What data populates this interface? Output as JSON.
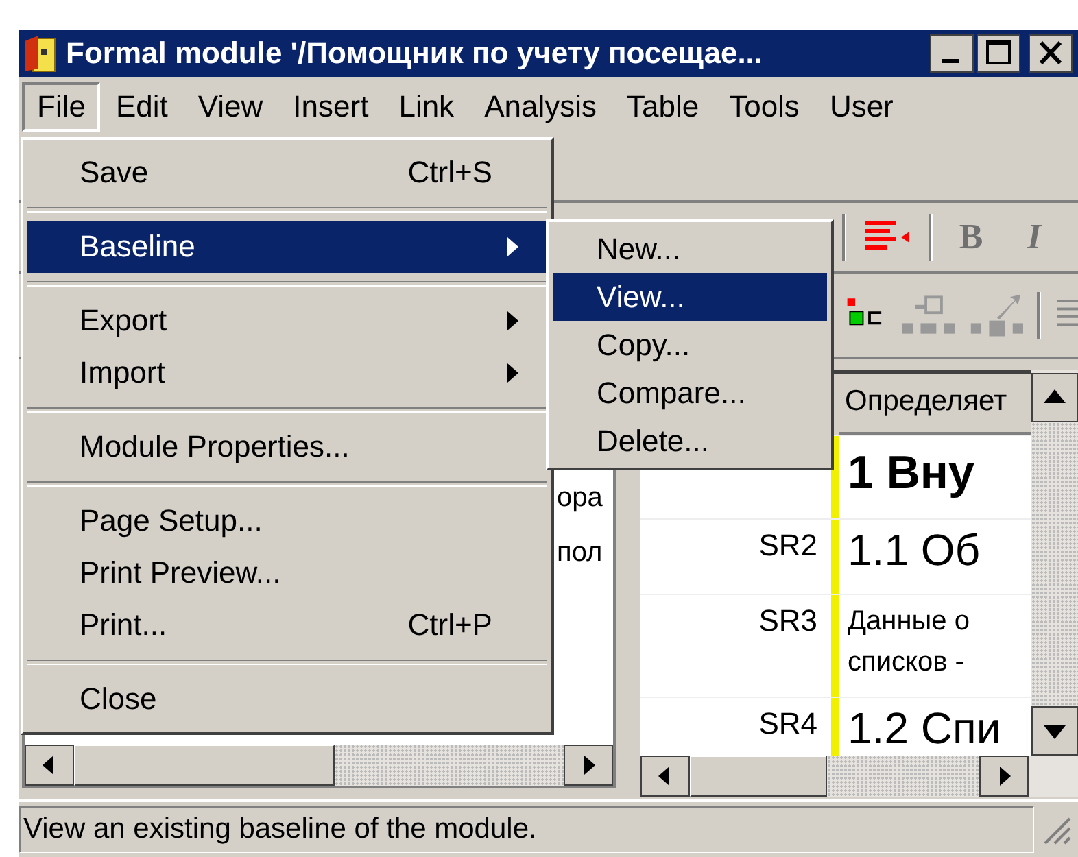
{
  "window": {
    "title": "Formal module '/Помощник по учету посещае..."
  },
  "menu_bar": [
    {
      "label": "File",
      "selected": true
    },
    {
      "label": "Edit",
      "selected": false
    },
    {
      "label": "View",
      "selected": false
    },
    {
      "label": "Insert",
      "selected": false
    },
    {
      "label": "Link",
      "selected": false
    },
    {
      "label": "Analysis",
      "selected": false
    },
    {
      "label": "Table",
      "selected": false
    },
    {
      "label": "Tools",
      "selected": false
    },
    {
      "label": "User",
      "selected": false
    }
  ],
  "file_menu": [
    {
      "kind": "item",
      "label": "Save",
      "shortcut": "Ctrl+S",
      "submenu": false,
      "selected": false
    },
    {
      "kind": "separator"
    },
    {
      "kind": "item",
      "label": "Baseline",
      "submenu": true,
      "selected": true
    },
    {
      "kind": "separator"
    },
    {
      "kind": "item",
      "label": "Export",
      "submenu": true,
      "selected": false
    },
    {
      "kind": "item",
      "label": "Import",
      "submenu": true,
      "selected": false
    },
    {
      "kind": "separator"
    },
    {
      "kind": "item",
      "label": "Module Properties...",
      "submenu": false,
      "selected": false
    },
    {
      "kind": "separator"
    },
    {
      "kind": "item",
      "label": "Page Setup...",
      "submenu": false,
      "selected": false
    },
    {
      "kind": "item",
      "label": "Print Preview...",
      "submenu": false,
      "selected": false
    },
    {
      "kind": "item",
      "label": "Print...",
      "shortcut": "Ctrl+P",
      "submenu": false,
      "selected": false
    },
    {
      "kind": "separator"
    },
    {
      "kind": "item",
      "label": "Close",
      "submenu": false,
      "selected": false
    }
  ],
  "baseline_submenu": [
    {
      "label": "New...",
      "selected": false
    },
    {
      "label": "View...",
      "selected": true
    },
    {
      "label": "Copy...",
      "selected": false
    },
    {
      "label": "Compare...",
      "selected": false
    },
    {
      "label": "Delete...",
      "selected": false
    }
  ],
  "toolbar": {
    "bold_button": "B",
    "italic_button": "I"
  },
  "left_pane": {
    "rows": [
      "ора",
      "пол"
    ]
  },
  "table": {
    "columns": [
      {
        "title": "Определяет"
      }
    ],
    "rows": [
      {
        "text": "1 Вну",
        "kind": "title"
      },
      {
        "id": "SR2",
        "text": "1.1 Об",
        "kind": "heading"
      },
      {
        "id": "SR3",
        "text": "Данные о\nсписков -",
        "kind": "text"
      },
      {
        "id": "SR4",
        "text": "1.2 Спи",
        "kind": "heading"
      }
    ]
  },
  "status_bar": {
    "text": "View an existing baseline of the module."
  }
}
